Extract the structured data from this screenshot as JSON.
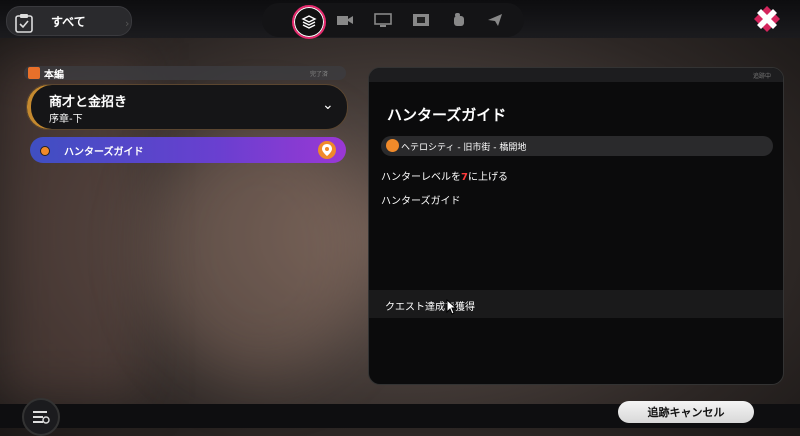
{
  "top_bar": {
    "filter_label": "すべて",
    "categories": [
      {
        "icon": "layers-icon",
        "active": true
      },
      {
        "icon": "camera-icon",
        "active": false
      },
      {
        "icon": "screen-icon",
        "active": false
      },
      {
        "icon": "film-icon",
        "active": false
      },
      {
        "icon": "fist-icon",
        "active": false
      },
      {
        "icon": "paper-plane-icon",
        "active": false
      }
    ],
    "close_icon": "close-icon"
  },
  "sidebar": {
    "section_label": "本編",
    "section_count": "完了済",
    "chapter": {
      "title": "商才と金招き",
      "subtitle": "序章-下"
    },
    "quest": {
      "label": "ハンターズガイド"
    }
  },
  "detail": {
    "header_tag": "追跡中",
    "title": "ハンターズガイド",
    "location": "ヘテロシティ - 旧市街 - 橋開地",
    "objective_pre": "ハンターレベルを",
    "objective_num": "7",
    "objective_post": "に上げる",
    "description": "ハンターズガイド",
    "reward_label": "クエスト達成で獲得"
  },
  "bottom": {
    "cancel_label": "追跡キャンセル"
  },
  "colors": {
    "accent": "#e62a6e",
    "orange": "#f08a2a",
    "quest_gradient_start": "#3f4fc2",
    "quest_gradient_end": "#9a38d4"
  }
}
